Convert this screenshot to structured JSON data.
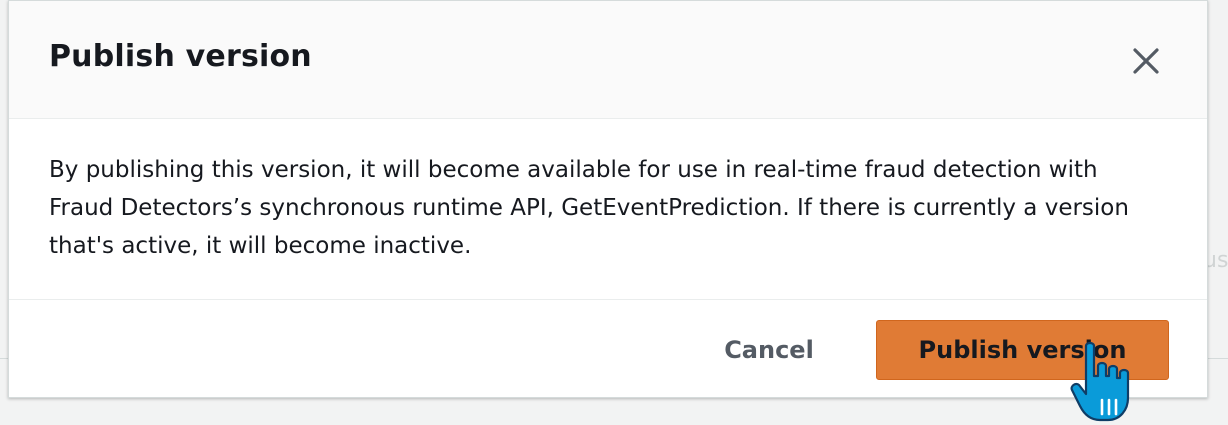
{
  "dialog": {
    "title": "Publish version",
    "body": "By publishing this version, it will become available for use in real-time fraud detection with Fraud Detectors’s synchronous runtime API, GetEventPrediction. If there is currently a version that's active, it will become inactive.",
    "close_icon": "close-icon",
    "cancel_label": "Cancel",
    "publish_label": "Publish version"
  },
  "background": {
    "partial_text": "us"
  },
  "colors": {
    "primary_button": "#e07b35",
    "cursor": "#0a9bd9"
  }
}
